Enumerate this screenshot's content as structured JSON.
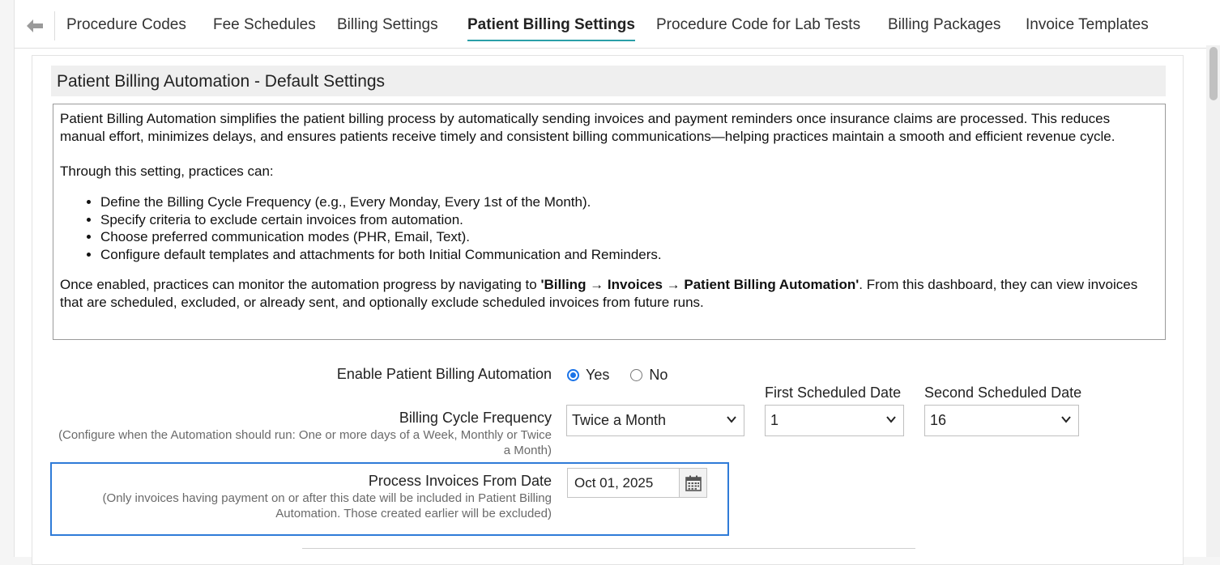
{
  "tabs": [
    {
      "label": "Procedure Codes"
    },
    {
      "label": "Fee Schedules"
    },
    {
      "label": "Billing Settings"
    },
    {
      "label": "Patient Billing Settings",
      "active": true
    },
    {
      "label": "Procedure Code for Lab Tests"
    },
    {
      "label": "Billing Packages"
    },
    {
      "label": "Invoice Templates"
    }
  ],
  "section": {
    "title": "Patient Billing Automation - Default Settings",
    "intro": "Patient Billing Automation simplifies the patient billing process by automatically sending invoices and payment reminders once insurance claims are processed. This reduces manual effort, minimizes delays, and ensures patients receive timely and consistent billing communications—helping practices maintain a smooth and efficient revenue cycle.",
    "list_heading": "Through this setting, practices can:",
    "bullets": [
      "Define the Billing Cycle Frequency (e.g., Every Monday, Every 1st of the Month).",
      "Specify criteria to exclude certain invoices from automation.",
      "Choose preferred communication modes (PHR, Email, Text).",
      "Configure default templates and attachments for both Initial Communication and Reminders."
    ],
    "outro_before": "Once enabled, practices can monitor the automation progress by navigating to ",
    "outro_path": "'Billing → Invoices → Patient Billing Automation'",
    "outro_after": ". From this dashboard, they can view invoices that are scheduled, excluded, or already sent, and optionally exclude scheduled invoices from future runs."
  },
  "form": {
    "enable": {
      "label": "Enable Patient Billing Automation",
      "yes_label": "Yes",
      "no_label": "No",
      "selected": "Yes"
    },
    "frequency": {
      "label": "Billing Cycle Frequency",
      "hint": "(Configure when the Automation should run: One or more days of a Week, Monthly or Twice a Month)",
      "value": "Twice a Month"
    },
    "first_date": {
      "label": "First Scheduled Date",
      "value": "1"
    },
    "second_date": {
      "label": "Second Scheduled Date",
      "value": "16"
    },
    "from_date": {
      "label": "Process Invoices From Date",
      "hint": "(Only invoices having payment on or after this date will be included in Patient Billing Automation. Those created earlier will be excluded)",
      "value": "Oct 01, 2025"
    }
  },
  "colors": {
    "accent_tab": "#2a9fa8",
    "radio_checked": "#1a73e8",
    "highlight_border": "#2f7bd8"
  }
}
